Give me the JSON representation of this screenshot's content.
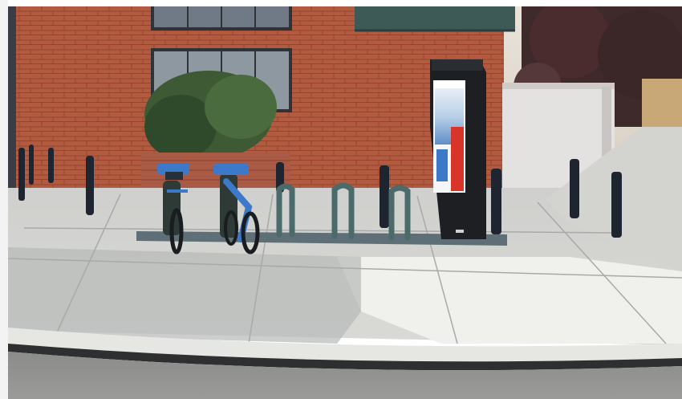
{
  "photo": {
    "scene": "street-corner-bike-station",
    "kiosk": {
      "screen_text": ""
    },
    "colors": {
      "brick": "#b0593f",
      "sidewalk": "#d8d8d4",
      "shadow": "#b4b6b6",
      "road": "#8e8e8c",
      "bike_blue": "#3c79c8",
      "kiosk_body": "#1d1f22",
      "bollard": "#1e2530"
    }
  }
}
